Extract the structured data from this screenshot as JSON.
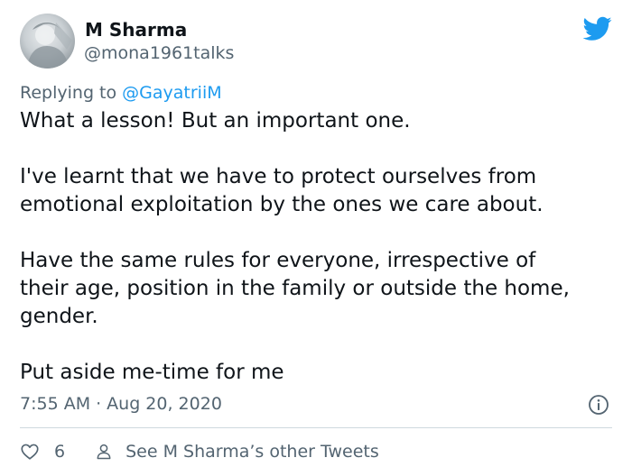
{
  "tweet": {
    "author_name": "M Sharma",
    "author_handle": "@mona1961talks",
    "replying_prefix": "Replying to",
    "replying_to": "@GayatriiM",
    "paragraphs": [
      "What a lesson! But an important one.",
      "I've learnt that we have to protect ourselves from",
      "emotional exploitation by the ones we care about.",
      "Have the same rules for everyone, irrespective of",
      "their age, position in the family or outside the home,",
      "gender.",
      "Put aside me-time for me"
    ],
    "time": "7:55 AM",
    "separator": "·",
    "date": "Aug 20, 2020",
    "like_count": "6",
    "other_tweets_label": "See M Sharma’s other Tweets"
  },
  "icons": {
    "brand": "twitter-bird-icon",
    "info": "info-icon",
    "like": "heart-icon",
    "profile": "person-icon"
  },
  "colors": {
    "brand_blue": "#1d9bf0",
    "text_primary": "#0f1419",
    "text_secondary": "#536471",
    "divider": "#cfd9de"
  }
}
